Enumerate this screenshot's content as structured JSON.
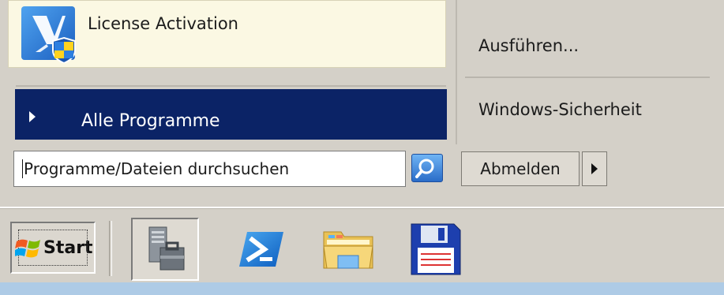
{
  "start_menu": {
    "pinned_items": [
      {
        "label": "License Activation",
        "icon": "license-activation-icon"
      }
    ],
    "all_programs_label": "Alle Programme",
    "right_items": [
      {
        "label": "Ausführen..."
      },
      {
        "label": "Windows-Sicherheit"
      }
    ],
    "search": {
      "placeholder": "Programme/Dateien durchsuchen",
      "value": "",
      "button_icon": "search-icon"
    },
    "logout_label": "Abmelden"
  },
  "taskbar": {
    "start_label": "Start",
    "quick_launch": [
      {
        "name": "server-manager",
        "icon": "server-manager-icon"
      },
      {
        "name": "powershell",
        "icon": "powershell-icon"
      },
      {
        "name": "file-explorer",
        "icon": "folder-icon"
      },
      {
        "name": "save-disk",
        "icon": "floppy-disk-icon"
      }
    ]
  },
  "colors": {
    "all_programs_bg": "#0b2366",
    "pinned_bg": "#fbf8e3",
    "chrome_bg": "#d4d0c8"
  }
}
